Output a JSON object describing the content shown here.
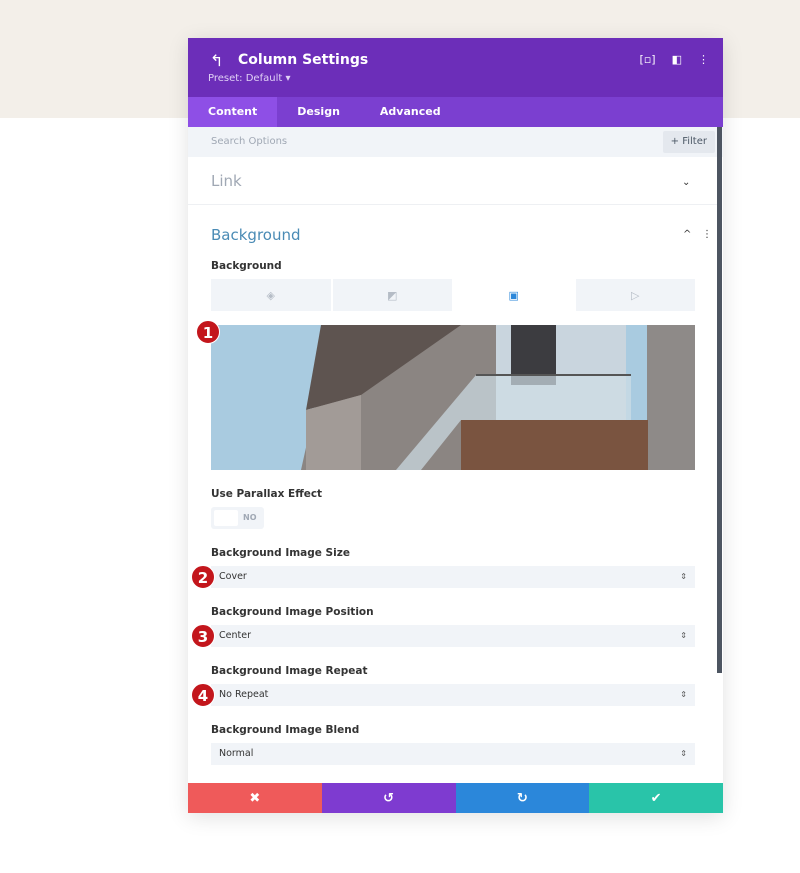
{
  "header": {
    "title": "Column Settings",
    "preset": "Preset: Default ▾"
  },
  "tabs": [
    {
      "label": "Content",
      "active": true
    },
    {
      "label": "Design"
    },
    {
      "label": "Advanced"
    }
  ],
  "search": {
    "placeholder": "Search Options",
    "filter_label": "+ Filter"
  },
  "sections": {
    "link": "Link",
    "background": "Background"
  },
  "background": {
    "label": "Background",
    "type_tabs": [
      "color",
      "gradient",
      "image",
      "video"
    ],
    "active_type": "image",
    "parallax_label": "Use Parallax Effect",
    "parallax_value": "NO",
    "fields": [
      {
        "label": "Background Image Size",
        "value": "Cover",
        "badge": "2"
      },
      {
        "label": "Background Image Position",
        "value": "Center",
        "badge": "3"
      },
      {
        "label": "Background Image Repeat",
        "value": "No Repeat",
        "badge": "4"
      },
      {
        "label": "Background Image Blend",
        "value": "Normal"
      }
    ],
    "image_badge": "1"
  },
  "footer": {
    "colors": {
      "cancel": "#ef5a5a",
      "undo": "#7e3bd0",
      "redo": "#2b87da",
      "save": "#29c4a9"
    }
  }
}
